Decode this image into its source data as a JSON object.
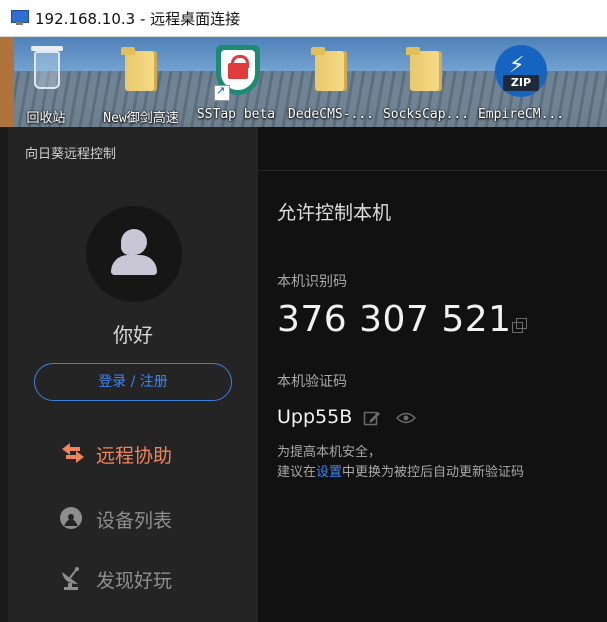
{
  "window": {
    "title": "192.168.10.3 - 远程桌面连接"
  },
  "desktop": {
    "icons": [
      {
        "label": "回收站",
        "icon": "recycle-bin-icon"
      },
      {
        "label": "New御剑高速",
        "icon": "folder-icon"
      },
      {
        "label": "SSTap beta",
        "icon": "sstap-shield-icon"
      },
      {
        "label": "DedeCMS-...",
        "icon": "folder-icon"
      },
      {
        "label": "SocksCap...",
        "icon": "folder-icon"
      },
      {
        "label": "EmpireCM...",
        "icon": "zip-archive-icon"
      }
    ],
    "zip_badge": "ZIP"
  },
  "app": {
    "title": "向日葵远程控制",
    "greeting": "你好",
    "login_label": "登录 / 注册",
    "nav": {
      "remote": "远程协助",
      "devices": "设备列表",
      "discover": "发现好玩"
    },
    "main": {
      "heading": "允许控制本机",
      "id_label": "本机识别码",
      "id_value": "376 307 521",
      "code_label": "本机验证码",
      "code_value": "Upp55B",
      "hint_line1": "为提高本机安全，",
      "hint_prefix": "建议在",
      "hint_link": "设置",
      "hint_suffix": "中更换为被控后自动更新验证码"
    }
  },
  "colors": {
    "accent_orange": "#f0845b",
    "accent_blue": "#3b86f2",
    "sidebar_bg": "#242424",
    "main_bg": "#111111"
  }
}
